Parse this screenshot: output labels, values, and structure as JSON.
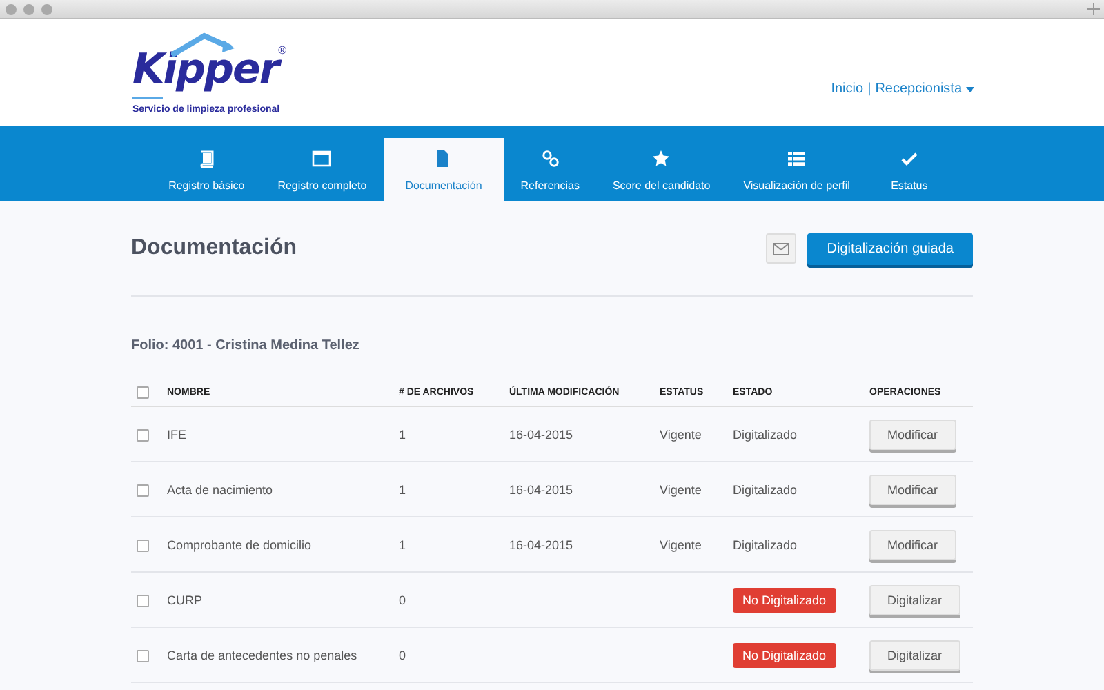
{
  "logo": {
    "name": "Kipper",
    "mark": "®",
    "tagline": "Servicio de limpieza profesional"
  },
  "user_menu": {
    "home": "Inicio",
    "separator": "|",
    "user": "Recepcionista"
  },
  "tabs": [
    {
      "label": "Registro básico",
      "selected": false
    },
    {
      "label": "Registro completo",
      "selected": false
    },
    {
      "label": "Documentación",
      "selected": true
    },
    {
      "label": "Referencias",
      "selected": false
    },
    {
      "label": "Score del candidato",
      "selected": false
    },
    {
      "label": "Visualización de perfil",
      "selected": false
    },
    {
      "label": "Estatus",
      "selected": false
    }
  ],
  "page": {
    "title": "Documentación",
    "primary_button": "Digitalización guiada"
  },
  "folio": "Folio: 4001 - Cristina Medina Tellez",
  "table": {
    "select_all_checked": false,
    "columns": [
      "NOMBRE",
      "# DE ARCHIVOS",
      "ÚLTIMA MODIFICACIÓN",
      "ESTATUS",
      "ESTADO",
      "OPERACIONES"
    ],
    "rows": [
      {
        "kind": "plain",
        "checked": false,
        "name": "IFE",
        "files": "1",
        "modified": "16-04-2015",
        "status": "Vigente",
        "state": "Digitalizado",
        "action": "Modificar"
      },
      {
        "kind": "plain",
        "checked": false,
        "name": "Acta de nacimiento",
        "files": "1",
        "modified": "16-04-2015",
        "status": "Vigente",
        "state": "Digitalizado",
        "action": "Modificar"
      },
      {
        "kind": "plain",
        "checked": false,
        "name": "Comprobante de domicilio",
        "files": "1",
        "modified": "16-04-2015",
        "status": "Vigente",
        "state": "Digitalizado",
        "action": "Modificar"
      },
      {
        "kind": "badge",
        "checked": false,
        "name": "CURP",
        "files": "0",
        "state": "No Digitalizado",
        "action": "Digitalizar"
      },
      {
        "kind": "badge",
        "checked": false,
        "name": "Carta de antecedentes no penales",
        "files": "0",
        "state": "No Digitalizado",
        "action": "Digitalizar"
      }
    ]
  }
}
